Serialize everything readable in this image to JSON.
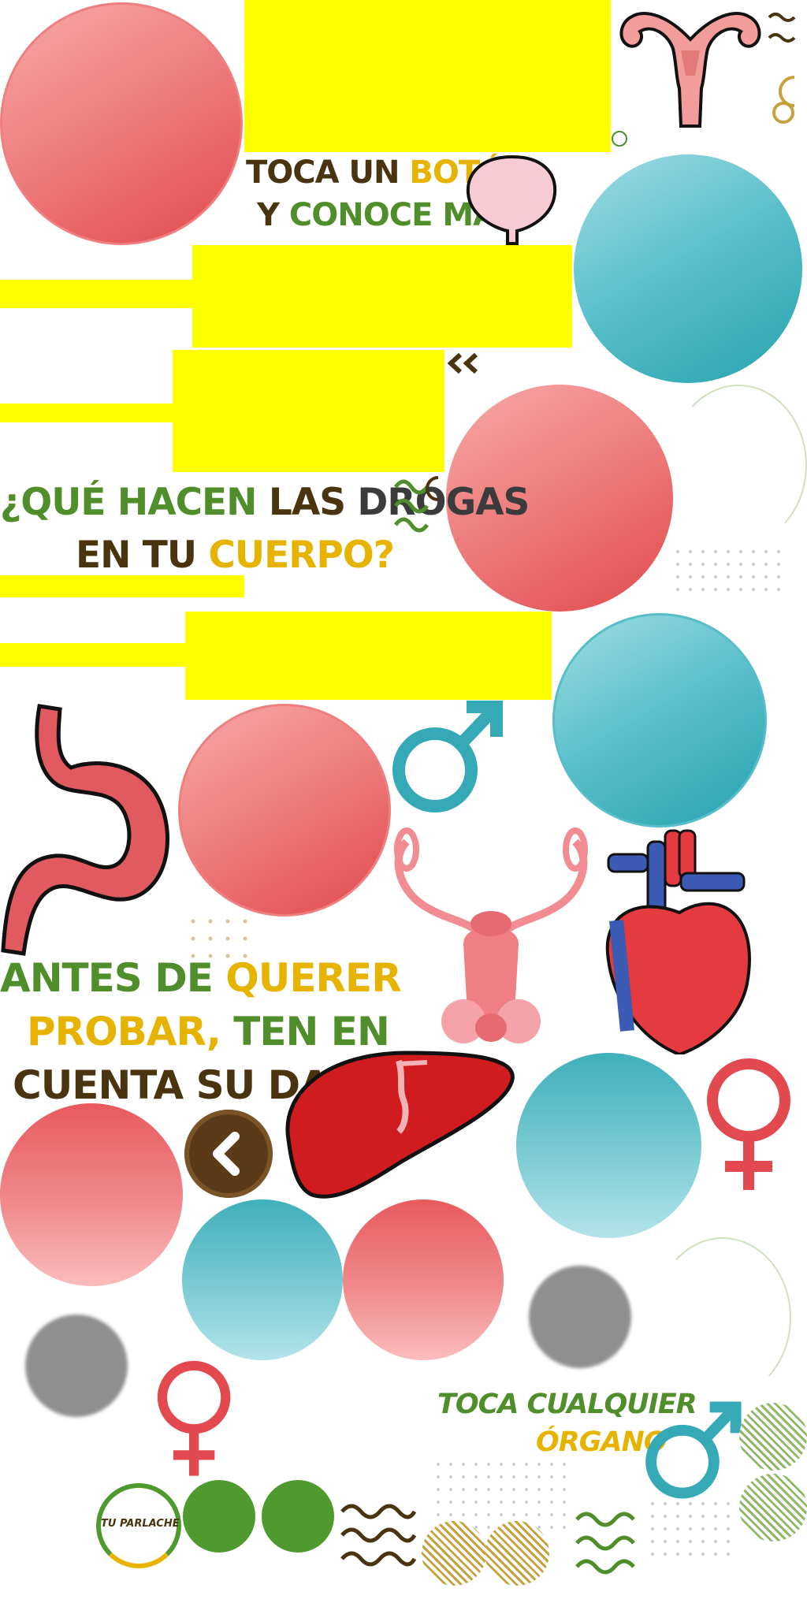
{
  "headings": {
    "toca_boton": {
      "w1": "TOCA UN ",
      "w2": "BOTÓN",
      "w3": "Y ",
      "w4": "CONOCE MÁS"
    },
    "que_hacen": {
      "w1": "¿QUÉ ",
      "w2": "HACEN ",
      "w3": "LAS ",
      "w4": "DROGAS",
      "w5": "EN TU ",
      "w6": "CUERPO?"
    },
    "antes": {
      "w1": "ANTES DE ",
      "w2": "QUERER",
      "w3": "PROBAR, ",
      "w4": "TEN EN",
      "w5": "CUENTA SU DAÑO"
    },
    "toca_organo": {
      "w1": "TOCA CUALQUIER",
      "w2": "ÓRGANO"
    }
  },
  "logo": {
    "text": "TU PARLACHE"
  },
  "colors": {
    "yellow": "#ffff00",
    "red": "#e14a4f",
    "teal": "#26a3af",
    "green": "#4f8e2a",
    "gold": "#e6b400",
    "brown": "#4a3410"
  },
  "icons": [
    "uterus-icon",
    "bladder-icon",
    "stomach-icon",
    "male-symbol-icon",
    "female-symbol-icon",
    "male-reproductive-icon",
    "heart-icon",
    "liver-icon",
    "back-chevron-icon",
    "double-chevron-icon",
    "wave-lines-icon",
    "speech-bubble-icon"
  ]
}
